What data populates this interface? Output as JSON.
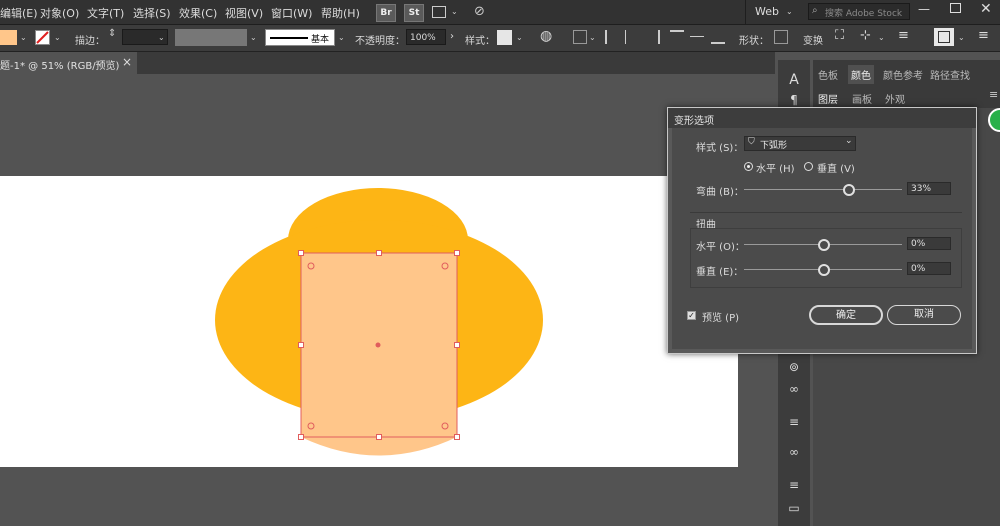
{
  "menubar": {
    "items": [
      "编辑(E)",
      "对象(O)",
      "文字(T)",
      "选择(S)",
      "效果(C)",
      "视图(V)",
      "窗口(W)",
      "帮助(H)"
    ],
    "br_label": "Br",
    "st_label": "St",
    "workspace": "Web",
    "search_placeholder": "搜索 Adobe Stock"
  },
  "controlbar": {
    "stroke_label": "描边：",
    "stroke_style": "基本",
    "opacity_label": "不透明度：",
    "opacity_value": "100%",
    "style_label": "样式：",
    "shape_label": "形状：",
    "transform_label": "变换",
    "fill_color": "#FFC68A"
  },
  "document": {
    "tab_title": "题-1* @ 51% (RGB/预览)",
    "close_glyph": "×"
  },
  "panels": {
    "top_tabs": [
      "色板",
      "颜色",
      "颜色参考",
      "路径查找"
    ],
    "sub_tabs": [
      "图层",
      "画板",
      "外观"
    ]
  },
  "dialog": {
    "title": "变形选项",
    "style_label": "样式 (S)：",
    "style_value": "下弧形",
    "horizontal_radio": "水平 (H)",
    "vertical_radio": "垂直 (V)",
    "bend_label": "弯曲 (B)：",
    "bend_value": "33%",
    "bend_percent": 33,
    "distort_section": "扭曲",
    "distort_h_label": "水平 (O)：",
    "distort_h_value": "0%",
    "distort_v_label": "垂直 (E)：",
    "distort_v_value": "0%",
    "preview_label": "预览 (P)",
    "ok_label": "确定",
    "cancel_label": "取消"
  },
  "colors": {
    "orange": "#FDB515",
    "peach": "#FFC68A",
    "selection": "#E05D5D"
  }
}
